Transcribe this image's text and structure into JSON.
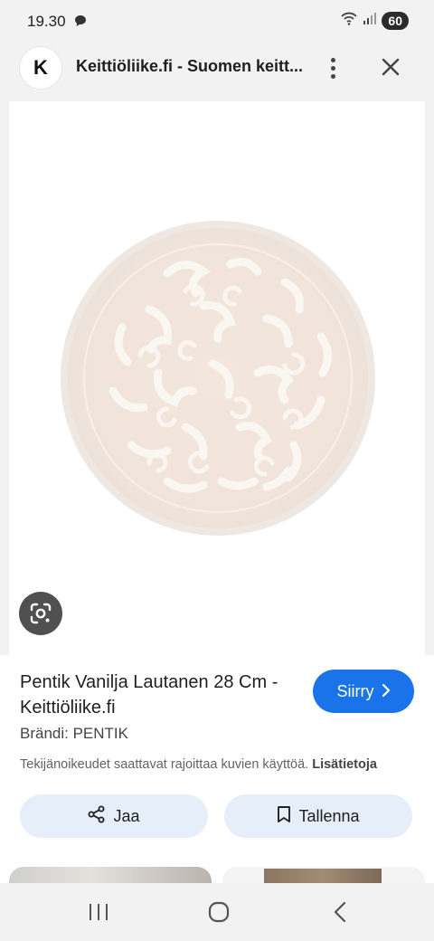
{
  "status_bar": {
    "time": "19.30",
    "battery": "60",
    "icons": [
      "chat-bubble-icon",
      "wifi-icon",
      "signal-icon",
      "battery-icon"
    ]
  },
  "header": {
    "logo_letter": "K",
    "title": "Keittiöliike.fi - Suomen keitt...",
    "icons": [
      "more-vert-icon",
      "close-icon"
    ]
  },
  "image": {
    "subject": "plate",
    "lens_icon": "google-lens-icon",
    "colors": {
      "plate": "#f4e8df",
      "pattern": "#fbf7f3"
    }
  },
  "product": {
    "title": "Pentik Vanilja Lautanen 28 Cm - Keittiöliike.fi",
    "go_label": "Siirry",
    "brand": "Brändi: PENTIK",
    "copyright_text": "Tekijänoikeudet saattavat rajoittaa kuvien käyttöä.",
    "more_info_link": "Lisätietoja",
    "share_label": "Jaa",
    "save_label": "Tallenna"
  },
  "colors": {
    "accent": "#1a73e8",
    "secondary_button": "#e6eef9"
  },
  "nav_bar": {
    "icons": [
      "recent-apps-icon",
      "home-icon",
      "back-icon"
    ]
  }
}
